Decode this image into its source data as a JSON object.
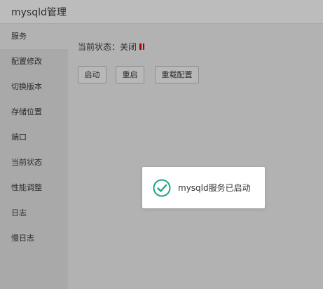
{
  "app": {
    "title": "mysqld管理"
  },
  "sidebar": {
    "items": [
      {
        "label": "服务",
        "active": true
      },
      {
        "label": "配置修改",
        "active": false
      },
      {
        "label": "切换版本",
        "active": false
      },
      {
        "label": "存储位置",
        "active": false
      },
      {
        "label": "端口",
        "active": false
      },
      {
        "label": "当前状态",
        "active": false
      },
      {
        "label": "性能调整",
        "active": false
      },
      {
        "label": "日志",
        "active": false
      },
      {
        "label": "慢日志",
        "active": false
      }
    ]
  },
  "service": {
    "status_label": "当前状态：",
    "status_value": "关闭",
    "status_icon": "pause-icon",
    "status_color": "#b00000"
  },
  "buttons": {
    "start": "启动",
    "restart": "重启",
    "reload_config": "重载配置"
  },
  "toast": {
    "message": "mysqld服务已启动",
    "icon": "check-circle-icon",
    "icon_color": "#20a48a"
  }
}
